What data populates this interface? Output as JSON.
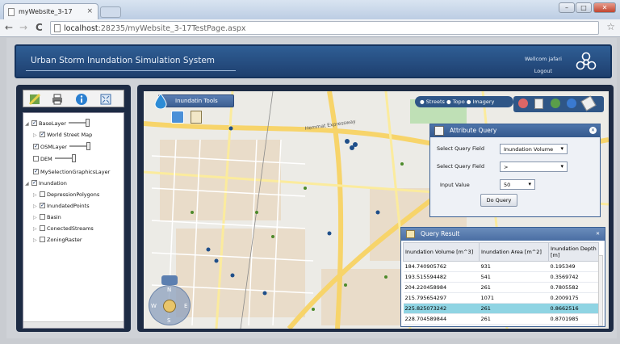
{
  "browser": {
    "tab_title": "myWebsite_3-17",
    "tab_close": "×",
    "url_host": "localhost",
    "url_path": ":28235/myWebsite_3-17TestPage.aspx",
    "back_icon": "←",
    "forward_icon": "→",
    "reload_icon": "C",
    "star_icon": "☆",
    "win_min": "–",
    "win_max": "□",
    "win_close": "✕"
  },
  "header": {
    "title": "Urban Storm Inundation Simulation System",
    "welcome": "Wellcom jafari",
    "logout": "Logout"
  },
  "layer_tree": {
    "nodes": [
      {
        "label": "BaseLayer",
        "checked": true,
        "slider": true,
        "expanded": true
      },
      {
        "label": "World Street Map",
        "checked": true
      },
      {
        "label": "OSMLayer",
        "checked": true,
        "slider": true
      },
      {
        "label": "DEM",
        "checked": false,
        "slider": true
      },
      {
        "label": "MySelectionGraphicsLayer",
        "checked": true
      },
      {
        "label": "Inundation",
        "checked": true,
        "expanded": true
      },
      {
        "label": "DepressionPolygons",
        "checked": false
      },
      {
        "label": "InundatedPoints",
        "checked": true
      },
      {
        "label": "Basin",
        "checked": false
      },
      {
        "label": "ConectedStreams",
        "checked": false
      },
      {
        "label": "ZoningRaster",
        "checked": false
      }
    ]
  },
  "map": {
    "tools_title": "Inundatin Tools",
    "basemap_options": [
      "Streets",
      "Topo",
      "Imagery"
    ],
    "road_label": "Hemmat Expressway",
    "compass": {
      "n": "N",
      "s": "S",
      "e": "E",
      "w": "W"
    }
  },
  "attribute_query": {
    "title": "Attribute Query",
    "field_label_1": "Select Query Field",
    "field_value_1": "Inundation Volume",
    "field_label_2": "Select Query Field",
    "field_value_2": ">",
    "input_label": "Input Value",
    "input_value": "50",
    "button": "Do Query"
  },
  "query_result": {
    "title": "Query Result",
    "columns": [
      "Inundation Volume [m^3]",
      "Inundation Area [m^2]",
      "Inundation Depth [m]"
    ],
    "rows": [
      [
        "184.740905762",
        "931",
        "0.195349"
      ],
      [
        "193.515594482",
        "541",
        "0.3569742"
      ],
      [
        "204.220458984",
        "261",
        "0.7805582"
      ],
      [
        "215.795654297",
        "1071",
        "0.2009175"
      ],
      [
        "225.825073242",
        "261",
        "0.8662516"
      ],
      [
        "228.704589844",
        "261",
        "0.8701985"
      ]
    ],
    "selected_row": 4
  },
  "colors": {
    "header_blue": "#2f5e95",
    "sidebar_navy": "#1d2b44",
    "selected_row": "#8fd4e3"
  }
}
